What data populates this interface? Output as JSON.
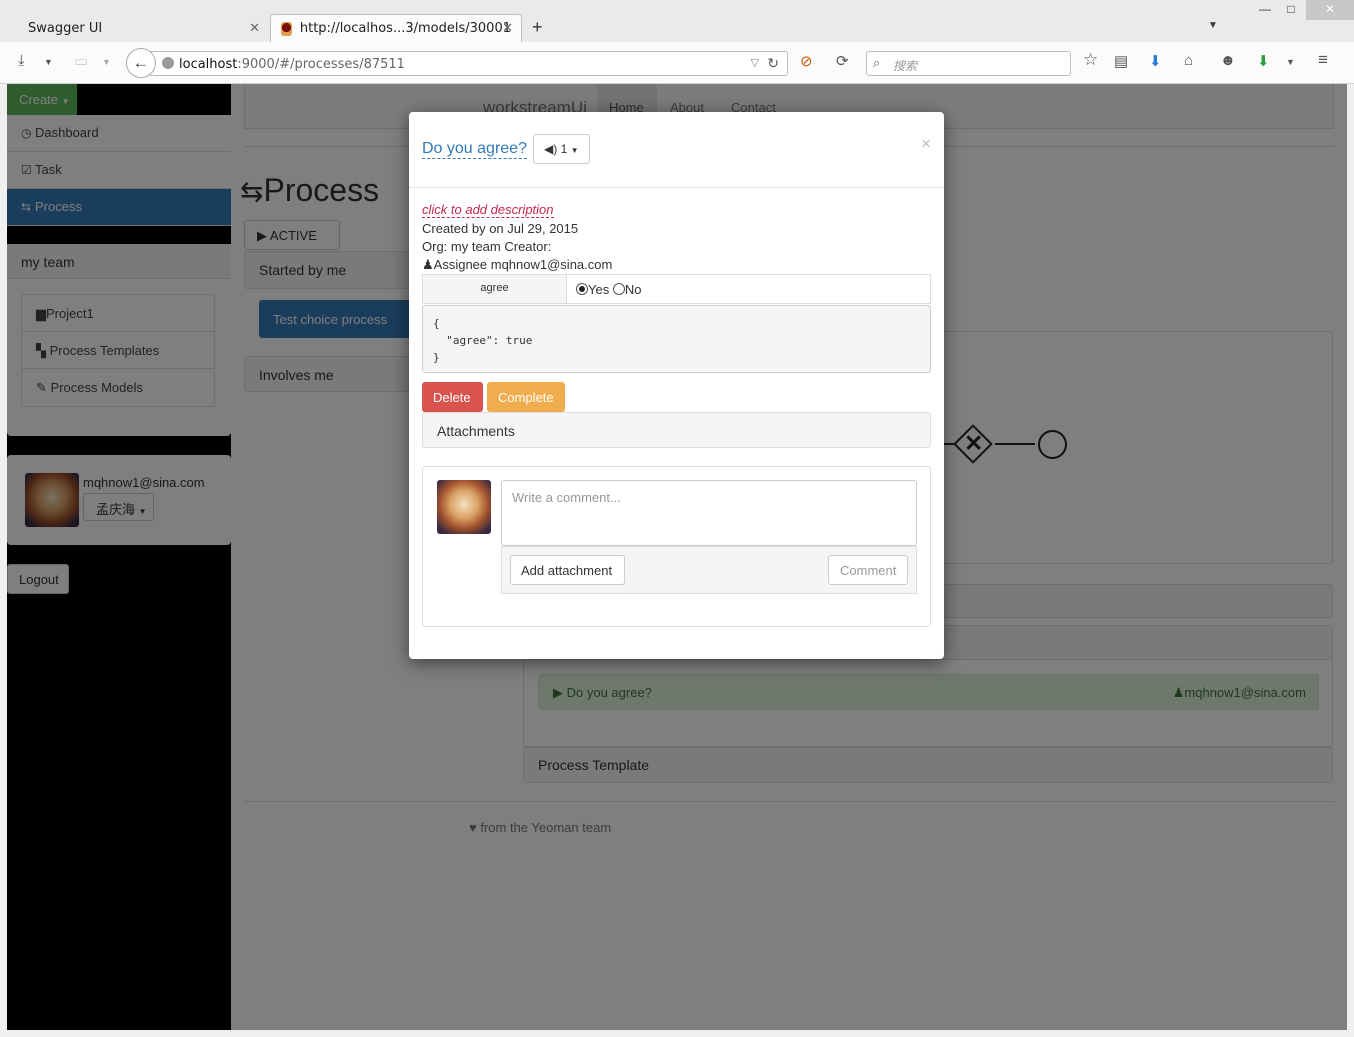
{
  "browser": {
    "tabs": [
      {
        "title": "Swagger UI",
        "active": false
      },
      {
        "title": "http://localhos...3/models/30001",
        "active": true
      }
    ],
    "url_host": "localhost",
    "url_rest": ":9000/#/processes/87511",
    "search_placeholder": "搜索"
  },
  "sidebar": {
    "create_label": "Create",
    "nav": [
      {
        "label": "Dashboard",
        "icon": "clock-icon",
        "glyph": "◷"
      },
      {
        "label": "Task",
        "icon": "checkbox-icon",
        "glyph": "☑"
      },
      {
        "label": "Process",
        "icon": "retweet-icon",
        "glyph": "⇆",
        "active": true
      }
    ],
    "team_title": "my team",
    "team_items": [
      {
        "label": "Project1",
        "icon": "briefcase-icon",
        "glyph": "▆"
      },
      {
        "label": "Process Templates",
        "icon": "bookmark-icon",
        "glyph": "▚"
      },
      {
        "label": "Process Models",
        "icon": "pencil-icon",
        "glyph": "✎"
      }
    ],
    "user_email": "mqhnow1@sina.com",
    "user_name": "孟庆海",
    "logout_label": "Logout"
  },
  "main": {
    "brand": "workstreamUi",
    "nav": [
      "Home",
      "About",
      "Contact"
    ],
    "page_title": "Process",
    "filter_label": "ACTIVE",
    "started_by_me": "Started by me",
    "test_process": "Test choice process",
    "involves_me": "Involves me",
    "task_name": "Do you agree?",
    "task_assignee": "mqhnow1@sina.com",
    "process_template": "Process Template",
    "footer": "from the Yeoman team"
  },
  "modal": {
    "title": "Do you agree?",
    "priority": "1",
    "description_prompt": "click to add description",
    "created_line": "Created by on Jul 29, 2015",
    "org_line": "Org: my team Creator:",
    "assignee_line": "Assignee mqhnow1@sina.com",
    "form_label": "agree",
    "option_yes": "Yes",
    "option_no": "No",
    "json_preview": "{\n  \"agree\": true\n}",
    "delete_label": "Delete",
    "complete_label": "Complete",
    "attachments_label": "Attachments",
    "comment_placeholder": "Write a comment...",
    "add_attachment_label": "Add attachment",
    "comment_label": "Comment"
  }
}
